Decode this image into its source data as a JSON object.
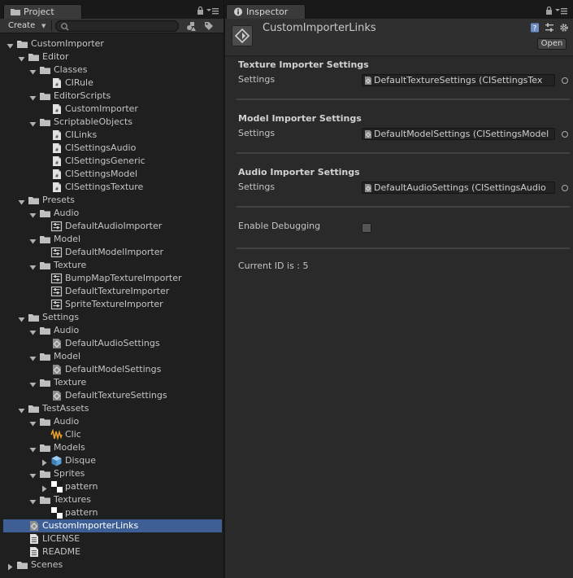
{
  "colors": {
    "selection": "#3e5f96",
    "panel_bg": "#2a2a2a",
    "folder": "#c8c8c8"
  },
  "project": {
    "tab_label": "Project",
    "tab_icon": "folder-icon",
    "create_label": "Create",
    "search": {
      "value": "",
      "icon": "search-icon"
    },
    "tree": [
      {
        "label": "CustomImporter",
        "depth": 0,
        "type": "folder",
        "expanded": true
      },
      {
        "label": "Editor",
        "depth": 1,
        "type": "folder",
        "expanded": true
      },
      {
        "label": "Classes",
        "depth": 2,
        "type": "folder",
        "expanded": true
      },
      {
        "label": "CIRule",
        "depth": 3,
        "type": "script"
      },
      {
        "label": "EditorScripts",
        "depth": 2,
        "type": "folder",
        "expanded": true
      },
      {
        "label": "CustomImporter",
        "depth": 3,
        "type": "script"
      },
      {
        "label": "ScriptableObjects",
        "depth": 2,
        "type": "folder",
        "expanded": true
      },
      {
        "label": "CILinks",
        "depth": 3,
        "type": "script"
      },
      {
        "label": "CISettingsAudio",
        "depth": 3,
        "type": "script"
      },
      {
        "label": "CISettingsGeneric",
        "depth": 3,
        "type": "script"
      },
      {
        "label": "CISettingsModel",
        "depth": 3,
        "type": "script"
      },
      {
        "label": "CISettingsTexture",
        "depth": 3,
        "type": "script"
      },
      {
        "label": "Presets",
        "depth": 1,
        "type": "folder",
        "expanded": true
      },
      {
        "label": "Audio",
        "depth": 2,
        "type": "folder",
        "expanded": true
      },
      {
        "label": "DefaultAudioImporter",
        "depth": 3,
        "type": "preset"
      },
      {
        "label": "Model",
        "depth": 2,
        "type": "folder",
        "expanded": true
      },
      {
        "label": "DefaultModelImporter",
        "depth": 3,
        "type": "preset"
      },
      {
        "label": "Texture",
        "depth": 2,
        "type": "folder",
        "expanded": true
      },
      {
        "label": "BumpMapTextureImporter",
        "depth": 3,
        "type": "preset"
      },
      {
        "label": "DefaultTextureImporter",
        "depth": 3,
        "type": "preset"
      },
      {
        "label": "SpriteTextureImporter",
        "depth": 3,
        "type": "preset"
      },
      {
        "label": "Settings",
        "depth": 1,
        "type": "folder",
        "expanded": true
      },
      {
        "label": "Audio",
        "depth": 2,
        "type": "folder",
        "expanded": true
      },
      {
        "label": "DefaultAudioSettings",
        "depth": 3,
        "type": "scriptable"
      },
      {
        "label": "Model",
        "depth": 2,
        "type": "folder",
        "expanded": true
      },
      {
        "label": "DefaultModelSettings",
        "depth": 3,
        "type": "scriptable"
      },
      {
        "label": "Texture",
        "depth": 2,
        "type": "folder",
        "expanded": true
      },
      {
        "label": "DefaultTextureSettings",
        "depth": 3,
        "type": "scriptable"
      },
      {
        "label": "TestAssets",
        "depth": 1,
        "type": "folder",
        "expanded": true
      },
      {
        "label": "Audio",
        "depth": 2,
        "type": "folder",
        "expanded": true
      },
      {
        "label": "Clic",
        "depth": 3,
        "type": "audio"
      },
      {
        "label": "Models",
        "depth": 2,
        "type": "folder",
        "expanded": true
      },
      {
        "label": "Disque",
        "depth": 3,
        "type": "model",
        "collapsible": true
      },
      {
        "label": "Sprites",
        "depth": 2,
        "type": "folder",
        "expanded": true
      },
      {
        "label": "pattern",
        "depth": 3,
        "type": "texture",
        "collapsible": true
      },
      {
        "label": "Textures",
        "depth": 2,
        "type": "folder",
        "expanded": true
      },
      {
        "label": "pattern",
        "depth": 3,
        "type": "texture"
      },
      {
        "label": "CustomImporterLinks",
        "depth": 1,
        "type": "scriptable",
        "selected": true
      },
      {
        "label": "LICENSE",
        "depth": 1,
        "type": "text"
      },
      {
        "label": "README",
        "depth": 1,
        "type": "text"
      },
      {
        "label": "Scenes",
        "depth": 0,
        "type": "folder",
        "expanded": false
      }
    ]
  },
  "inspector": {
    "tab_label": "Inspector",
    "tab_icon": "info-icon",
    "asset_title": "CustomImporterLinks",
    "open_label": "Open",
    "sections": [
      {
        "title": "Texture Importer Settings",
        "field_label": "Settings",
        "value": "DefaultTextureSettings (CISettingsTex"
      },
      {
        "title": "Model Importer Settings",
        "field_label": "Settings",
        "value": "DefaultModelSettings (CISettingsModel"
      },
      {
        "title": "Audio Importer Settings",
        "field_label": "Settings",
        "value": "DefaultAudioSettings (CISettingsAudio"
      }
    ],
    "debug_label": "Enable Debugging",
    "debug_enabled": false,
    "current_id_text": "Current ID is : 5"
  }
}
